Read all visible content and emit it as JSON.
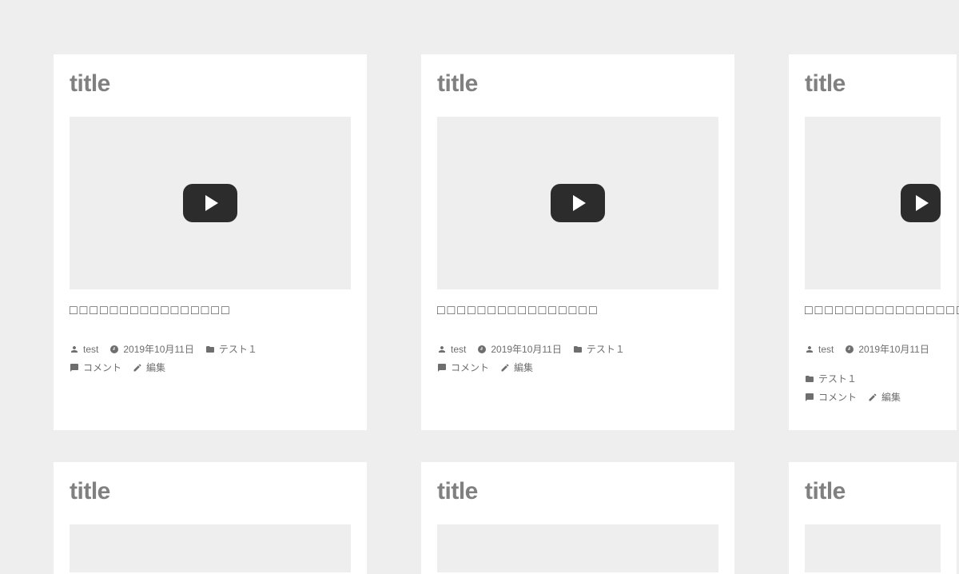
{
  "cards": [
    {
      "title": "title",
      "excerpt": "□□□□□□□□□□□□□□□□",
      "author": "test",
      "date": "2019年10月11日",
      "category": "テスト１",
      "comments": "コメント",
      "edit": "編集"
    },
    {
      "title": "title",
      "excerpt": "□□□□□□□□□□□□□□□□",
      "author": "test",
      "date": "2019年10月11日",
      "category": "テスト１",
      "comments": "コメント",
      "edit": "編集"
    },
    {
      "title": "title",
      "excerpt": "□□□□□□□□□□□□□□□□",
      "author": "test",
      "date": "2019年10月11日",
      "category": "テスト１",
      "comments": "コメント",
      "edit": "編集"
    },
    {
      "title": "title"
    },
    {
      "title": "title"
    },
    {
      "title": "title"
    }
  ]
}
